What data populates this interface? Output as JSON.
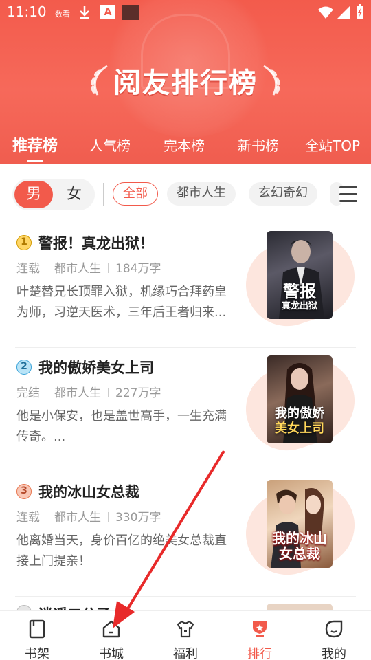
{
  "status_bar": {
    "time": "11:10",
    "carrier_icon": "数看",
    "download_icon": "download-icon",
    "app_icon": "A"
  },
  "banner": {
    "title": "阅友排行榜"
  },
  "rank_tabs": [
    {
      "label": "推荐榜",
      "active": true
    },
    {
      "label": "人气榜",
      "active": false
    },
    {
      "label": "完本榜",
      "active": false
    },
    {
      "label": "新书榜",
      "active": false
    },
    {
      "label": "全站TOP",
      "active": false
    }
  ],
  "gender": {
    "male": "男",
    "female": "女",
    "selected": "男"
  },
  "categories": [
    {
      "label": "全部",
      "active": true
    },
    {
      "label": "都市人生",
      "active": false
    },
    {
      "label": "玄幻奇幻",
      "active": false
    }
  ],
  "books": [
    {
      "rank": "1",
      "title": "警报！真龙出狱！",
      "status": "连载",
      "genre": "都市人生",
      "words": "184万字",
      "desc": "叶楚替兄长顶罪入狱，机缘巧合拜药皇为师，习逆天医术，三年后王者归来...",
      "cover_big": "警报",
      "cover_small": "真龙出狱"
    },
    {
      "rank": "2",
      "title": "我的傲娇美女上司",
      "status": "完结",
      "genre": "都市人生",
      "words": "227万字",
      "desc": "他是小保安，也是盖世高手，一生充满传奇。...",
      "cover_big": "我的傲娇",
      "cover_small": "美女上司"
    },
    {
      "rank": "3",
      "title": "我的冰山女总裁",
      "status": "连载",
      "genre": "都市人生",
      "words": "330万字",
      "desc": "他离婚当天，身价百亿的绝美女总裁直接上门提亲！",
      "cover_big": "我的冰山",
      "cover_small": "女总裁"
    }
  ],
  "partial_book": {
    "title": "逍遥二公子"
  },
  "bottom_nav": [
    {
      "label": "书架",
      "icon": "bookshelf-icon",
      "active": false
    },
    {
      "label": "书城",
      "icon": "bookstore-icon",
      "active": false
    },
    {
      "label": "福利",
      "icon": "welfare-icon",
      "active": false
    },
    {
      "label": "排行",
      "icon": "ranking-icon",
      "active": true
    },
    {
      "label": "我的",
      "icon": "profile-icon",
      "active": false
    }
  ],
  "colors": {
    "accent": "#f25a4b",
    "badge_gold": "#e8a400",
    "badge_blue": "#3aa3d8",
    "badge_orange": "#e8764f"
  }
}
